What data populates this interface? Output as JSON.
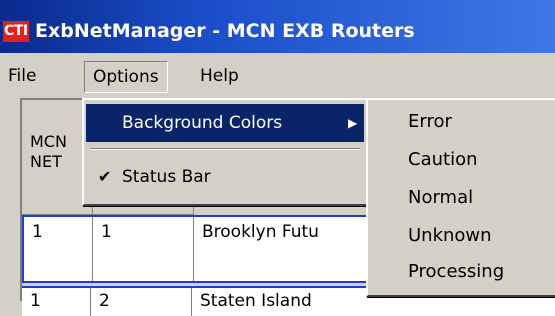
{
  "window": {
    "logo_text": "CTI",
    "title": "ExbNetManager - MCN EXB Routers"
  },
  "menubar": {
    "file": "File",
    "options": "Options",
    "help": "Help"
  },
  "grid": {
    "header_col1": "MCN\nNET",
    "rows": [
      {
        "c1": "1",
        "c2": "1",
        "c3": "Brooklyn  Futu"
      },
      {
        "c1": "1",
        "c2": "2",
        "c3": "Staten Island"
      }
    ]
  },
  "options_menu": {
    "background_colors": "Background Colors",
    "status_bar": "Status Bar",
    "status_bar_checked": true
  },
  "colors_menu": {
    "items": [
      "Error",
      "Caution",
      "Normal",
      "Unknown",
      "Processing"
    ]
  }
}
